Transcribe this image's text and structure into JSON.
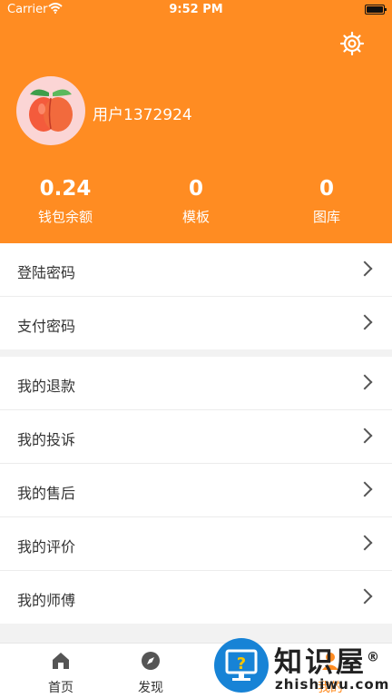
{
  "status": {
    "carrier": "Carrier",
    "time": "9:52 PM"
  },
  "profile": {
    "username": "用户1372924"
  },
  "stats": [
    {
      "value": "0.24",
      "label": "钱包余额"
    },
    {
      "value": "0",
      "label": "模板"
    },
    {
      "value": "0",
      "label": "图库"
    }
  ],
  "menu_group_1": [
    "登陆密码",
    "支付密码"
  ],
  "menu_group_2": [
    "我的退款",
    "我的投诉",
    "我的售后",
    "我的评价",
    "我的师傅"
  ],
  "tabs": [
    {
      "label": "首页",
      "icon": "home-icon"
    },
    {
      "label": "发现",
      "icon": "compass-icon"
    },
    {
      "label": "我的",
      "icon": "person-icon"
    }
  ],
  "watermark": {
    "name": "知识屋",
    "domain": "zhishiwu.com",
    "mark": "®"
  },
  "colors": {
    "accent": "#ff8c22",
    "background": "#f2f2f2",
    "watermark": "#1783d6"
  }
}
